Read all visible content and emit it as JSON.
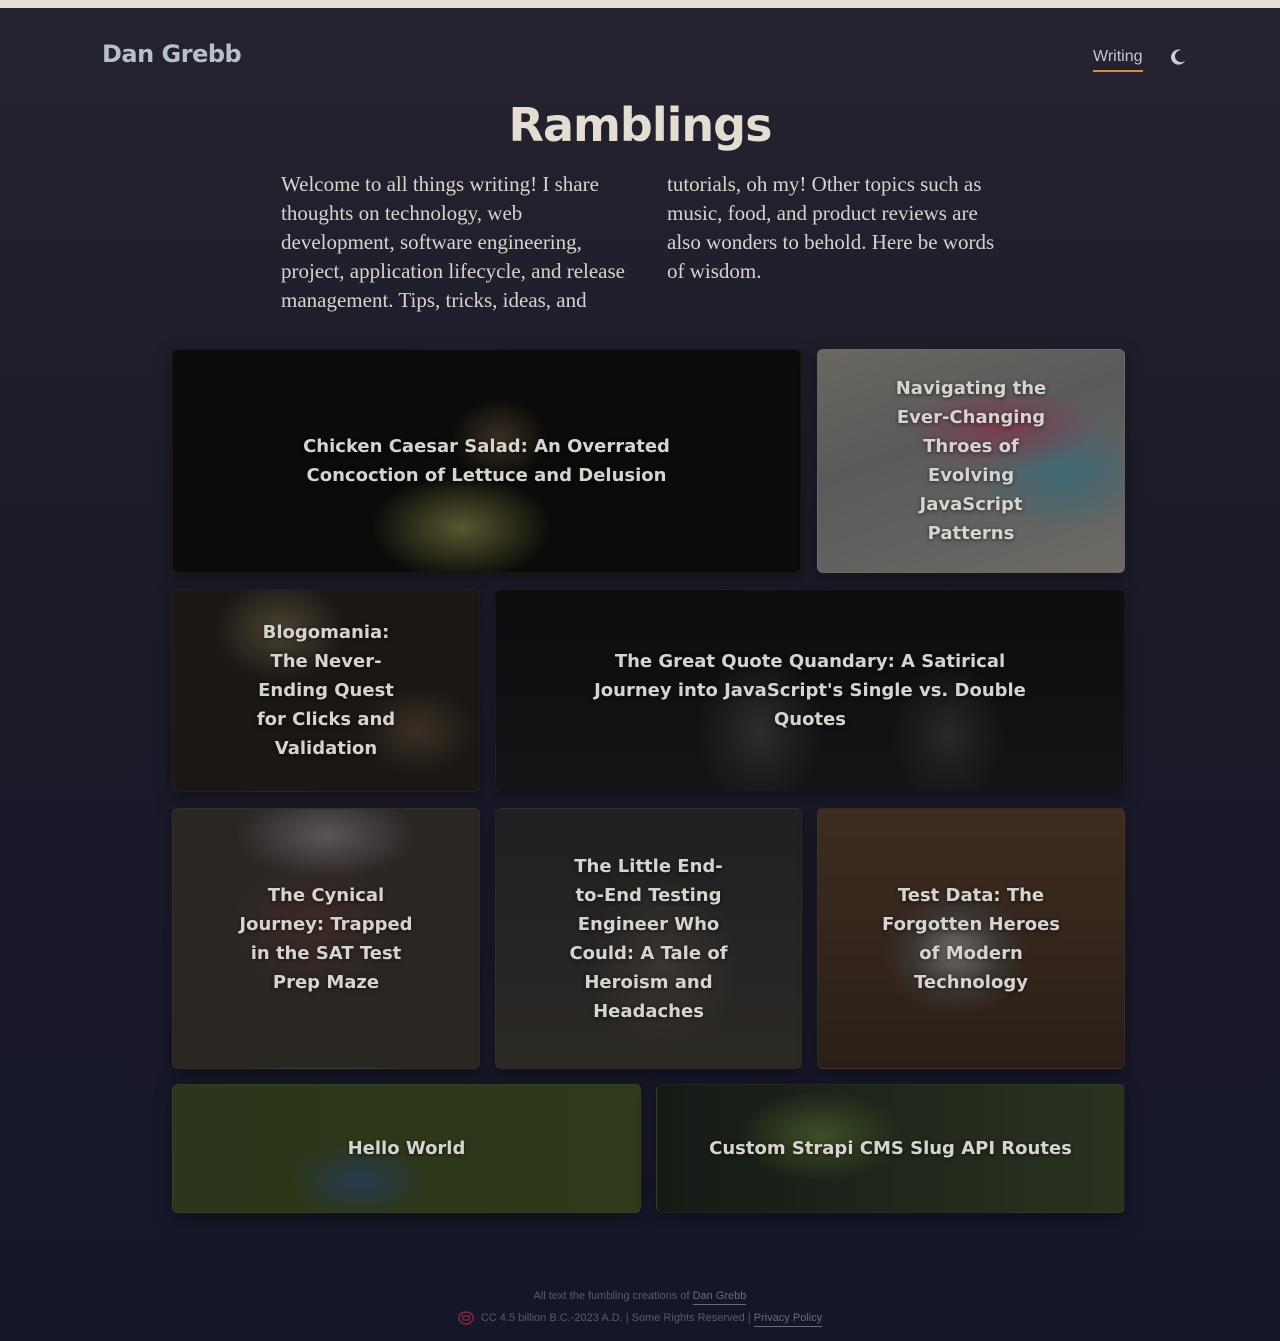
{
  "header": {
    "brand": "Dan Grebb",
    "nav": [
      {
        "label": "Writing"
      }
    ],
    "theme_toggle_icon": "moon-icon"
  },
  "main": {
    "title": "Ramblings",
    "intro": "Welcome to all things writing! I share thoughts on technology, web development, software engineering, project, application lifecycle, and release management. Tips, tricks, ideas, and tutorials, oh my! Other topics such as music, food, and product reviews are also wonders to behold. Here be words of wisdom.",
    "posts": [
      {
        "title": "Chicken Caesar Salad: An Overrated Concoction of Lettuce and Delusion"
      },
      {
        "title": "Navigating the Ever-Changing Throes of Evolving JavaScript Patterns"
      },
      {
        "title": "Blogomania: The Never-Ending Quest for Clicks and Validation"
      },
      {
        "title": "The Great Quote Quandary: A Satirical Journey into JavaScript's Single vs. Double Quotes"
      },
      {
        "title": "The Cynical Journey: Trapped in the SAT Test Prep Maze"
      },
      {
        "title": "The Little End-to-End Testing Engineer Who Could: A Tale of Heroism and Headaches"
      },
      {
        "title": "Test Data: The Forgotten Heroes of Modern Technology"
      },
      {
        "title": "Hello World"
      },
      {
        "title": "Custom Strapi CMS Slug API Routes"
      }
    ]
  },
  "footer": {
    "line1_text": "All text the fumbling creations of",
    "line1_link": "Dan Grebb",
    "license_icon": "creative-commons-icon",
    "line2_text": "CC 4.5 billion B.C.-2023 A.D. | Some Rights Reserved |",
    "privacy_link": "Privacy Policy"
  },
  "colors": {
    "accent_underline": "#d98a3a",
    "background": "#1c1b29",
    "top_bar": "#e6ddd3"
  }
}
